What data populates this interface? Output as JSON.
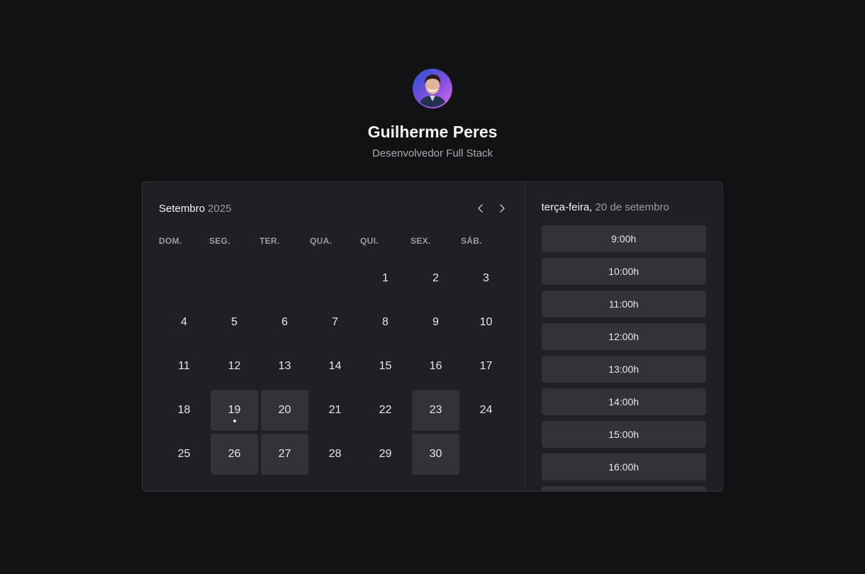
{
  "profile": {
    "name": "Guilherme Peres",
    "role": "Desenvolvedor Full Stack"
  },
  "calendar": {
    "month": "Setembro",
    "year": "2025",
    "weekdays": [
      "DOM.",
      "SEG.",
      "TER.",
      "QUA.",
      "QUI.",
      "SEX.",
      "SÁB."
    ],
    "leading_blanks": 4,
    "days": [
      {
        "label": "1",
        "available": false
      },
      {
        "label": "2",
        "available": false
      },
      {
        "label": "3",
        "available": false
      },
      {
        "label": "4",
        "available": false
      },
      {
        "label": "5",
        "available": false
      },
      {
        "label": "6",
        "available": false
      },
      {
        "label": "7",
        "available": false
      },
      {
        "label": "8",
        "available": false
      },
      {
        "label": "9",
        "available": false
      },
      {
        "label": "10",
        "available": false
      },
      {
        "label": "11",
        "available": false
      },
      {
        "label": "12",
        "available": false
      },
      {
        "label": "13",
        "available": false
      },
      {
        "label": "14",
        "available": false
      },
      {
        "label": "15",
        "available": false
      },
      {
        "label": "16",
        "available": false
      },
      {
        "label": "17",
        "available": false
      },
      {
        "label": "18",
        "available": false
      },
      {
        "label": "19",
        "available": true,
        "today": true
      },
      {
        "label": "20",
        "available": true
      },
      {
        "label": "21",
        "available": false
      },
      {
        "label": "22",
        "available": false
      },
      {
        "label": "23",
        "available": true
      },
      {
        "label": "24",
        "available": false
      },
      {
        "label": "25",
        "available": false
      },
      {
        "label": "26",
        "available": true
      },
      {
        "label": "27",
        "available": true
      },
      {
        "label": "28",
        "available": false
      },
      {
        "label": "29",
        "available": false
      },
      {
        "label": "30",
        "available": true
      }
    ]
  },
  "times": {
    "weekday": "terça-feira,",
    "date": "20 de setembro",
    "slots": [
      "9:00h",
      "10:00h",
      "11:00h",
      "12:00h",
      "13:00h",
      "14:00h",
      "15:00h",
      "16:00h",
      ""
    ]
  },
  "colors": {
    "background": "#121214",
    "card": "#202024",
    "available_day": "#323238"
  }
}
